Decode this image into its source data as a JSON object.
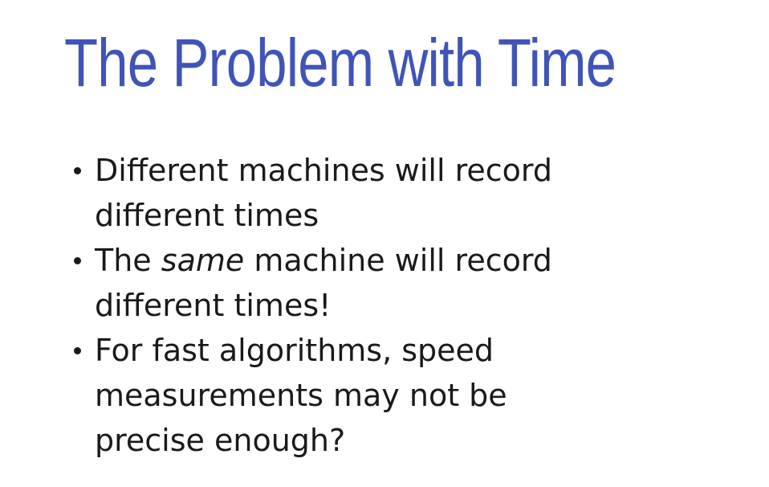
{
  "slide": {
    "title": "The Problem with Time",
    "title_color": "#4054b8",
    "text_color": "#1a1a1a",
    "bullets": [
      {
        "line1": "Different machines will record",
        "line2": "different times"
      },
      {
        "line1_before": "The ",
        "line1_emphasis": "same",
        "line1_after": " machine will record",
        "line2": "different times!"
      },
      {
        "line1": "For fast algorithms, speed",
        "line2": "measurements may not be",
        "line3": "precise enough?"
      }
    ]
  }
}
